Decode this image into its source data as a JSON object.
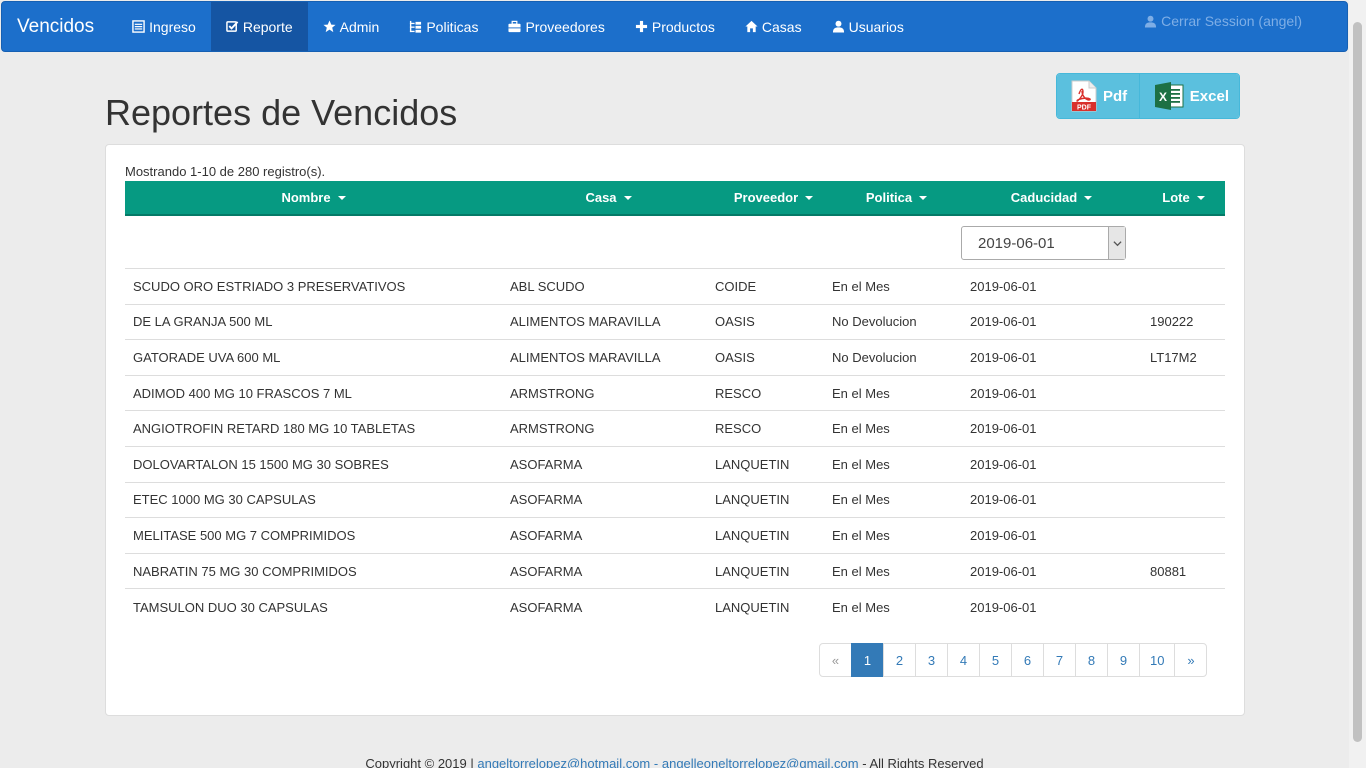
{
  "nav": {
    "brand": "Vencidos",
    "items": [
      {
        "label": "Ingreso",
        "icon": "list-icon"
      },
      {
        "label": "Reporte",
        "icon": "check-square-icon",
        "active": true
      },
      {
        "label": "Admin",
        "icon": "star-icon"
      },
      {
        "label": "Politicas",
        "icon": "tree-icon"
      },
      {
        "label": "Proveedores",
        "icon": "briefcase-icon"
      },
      {
        "label": "Productos",
        "icon": "plus-icon"
      },
      {
        "label": "Casas",
        "icon": "home-icon"
      },
      {
        "label": "Usuarios",
        "icon": "user-icon"
      }
    ],
    "logout": "Cerrar Session (angel)"
  },
  "page": {
    "title": "Reportes de Vencidos"
  },
  "export": {
    "pdf_label": "Pdf",
    "excel_label": "Excel",
    "pdf_icon_text": "PDF",
    "excel_icon_text": "X"
  },
  "table": {
    "summary": "Mostrando 1-10 de 280 registro(s).",
    "headers": {
      "nombre": "Nombre",
      "casa": "Casa",
      "proveedor": "Proveedor",
      "politica": "Politica",
      "caducidad": "Caducidad",
      "lote": "Lote"
    },
    "filter_date": "2019-06-01",
    "rows": [
      {
        "nombre": "SCUDO ORO ESTRIADO 3 PRESERVATIVOS",
        "casa": "ABL SCUDO",
        "proveedor": "COIDE",
        "politica": "En el Mes",
        "caducidad": "2019-06-01",
        "lote": ""
      },
      {
        "nombre": "DE LA GRANJA 500 ML",
        "casa": "ALIMENTOS MARAVILLA",
        "proveedor": "OASIS",
        "politica": "No Devolucion",
        "caducidad": "2019-06-01",
        "lote": "190222"
      },
      {
        "nombre": "GATORADE UVA 600 ML",
        "casa": "ALIMENTOS MARAVILLA",
        "proveedor": "OASIS",
        "politica": "No Devolucion",
        "caducidad": "2019-06-01",
        "lote": "LT17M2"
      },
      {
        "nombre": "ADIMOD 400 MG 10 FRASCOS 7 ML",
        "casa": "ARMSTRONG",
        "proveedor": "RESCO",
        "politica": "En el Mes",
        "caducidad": "2019-06-01",
        "lote": ""
      },
      {
        "nombre": "ANGIOTROFIN RETARD 180 MG 10 TABLETAS",
        "casa": "ARMSTRONG",
        "proveedor": "RESCO",
        "politica": "En el Mes",
        "caducidad": "2019-06-01",
        "lote": ""
      },
      {
        "nombre": "DOLOVARTALON 15 1500 MG 30 SOBRES",
        "casa": "ASOFARMA",
        "proveedor": "LANQUETIN",
        "politica": "En el Mes",
        "caducidad": "2019-06-01",
        "lote": ""
      },
      {
        "nombre": "ETEC 1000 MG 30 CAPSULAS",
        "casa": "ASOFARMA",
        "proveedor": "LANQUETIN",
        "politica": "En el Mes",
        "caducidad": "2019-06-01",
        "lote": ""
      },
      {
        "nombre": "MELITASE 500 MG 7 COMPRIMIDOS",
        "casa": "ASOFARMA",
        "proveedor": "LANQUETIN",
        "politica": "En el Mes",
        "caducidad": "2019-06-01",
        "lote": ""
      },
      {
        "nombre": "NABRATIN 75 MG 30 COMPRIMIDOS",
        "casa": "ASOFARMA",
        "proveedor": "LANQUETIN",
        "politica": "En el Mes",
        "caducidad": "2019-06-01",
        "lote": "80881"
      },
      {
        "nombre": "TAMSULON DUO 30 CAPSULAS",
        "casa": "ASOFARMA",
        "proveedor": "LANQUETIN",
        "politica": "En el Mes",
        "caducidad": "2019-06-01",
        "lote": ""
      }
    ]
  },
  "pagination": {
    "prev": "«",
    "next": "»",
    "pages": [
      "1",
      "2",
      "3",
      "4",
      "5",
      "6",
      "7",
      "8",
      "9",
      "10"
    ],
    "current": "1"
  },
  "footer": {
    "prefix": "Copyright © 2019 |",
    "email1": "angeltorrelopez@hotmail.com",
    "separator": "-",
    "email2": "angelleoneltorrelopez@gmail.com",
    "suffix": "- All Rights Reserved"
  },
  "colors": {
    "navbar": "#1c6fcb",
    "navbar_active": "#1555a3",
    "table_header": "#069a82",
    "export_button": "#5bc0de",
    "link": "#337ab7"
  }
}
